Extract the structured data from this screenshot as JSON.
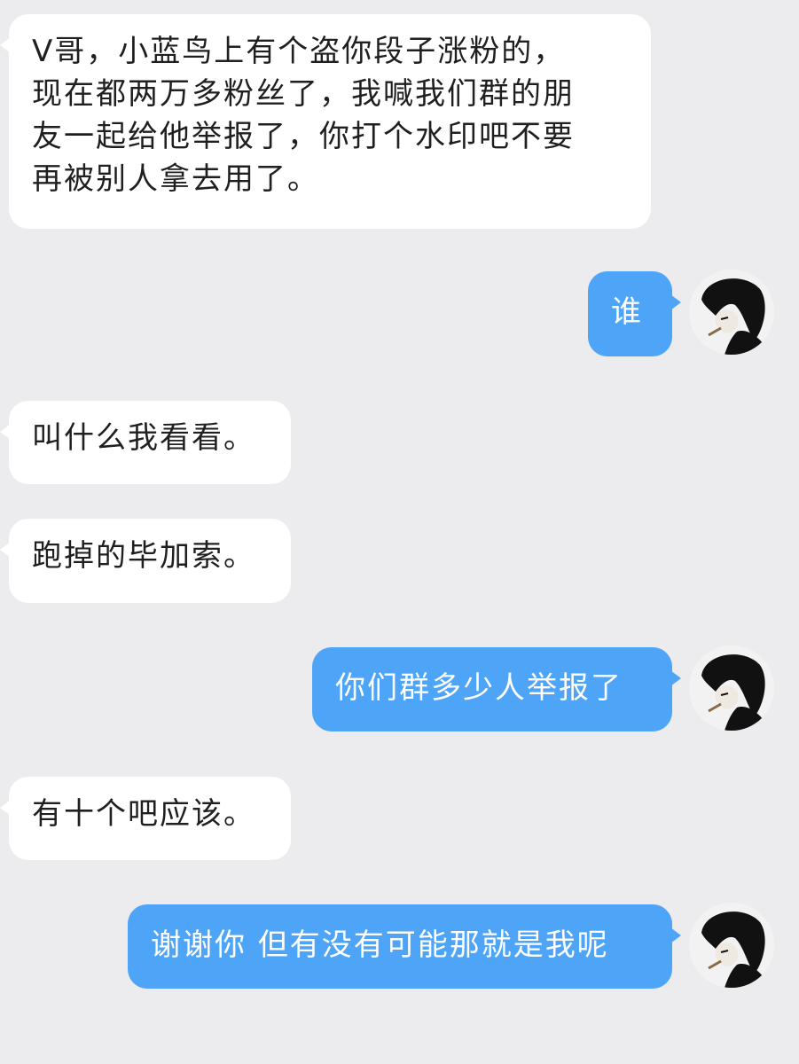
{
  "messages": [
    {
      "side": "incoming",
      "text": "V哥，小蓝鸟上有个盗你段子涨粉的，\n现在都两万多粉丝了，我喊我们群的朋\n友一起给他举报了，你打个水印吧不要\n再被别人拿去用了。"
    },
    {
      "side": "outgoing",
      "text": "谁",
      "avatar": "portrait-avatar"
    },
    {
      "side": "incoming",
      "text": "叫什么我看看。"
    },
    {
      "side": "incoming",
      "text": "跑掉的毕加索。"
    },
    {
      "side": "outgoing",
      "text": "你们群多少人举报了",
      "avatar": "portrait-avatar"
    },
    {
      "side": "incoming",
      "text": "有十个吧应该。"
    },
    {
      "side": "outgoing",
      "text": "谢谢你 但有没有可能那就是我呢",
      "avatar": "portrait-avatar"
    }
  ],
  "colors": {
    "background": "#ececee",
    "incoming_bubble": "#ffffff",
    "outgoing_bubble": "#4ea5f7"
  }
}
